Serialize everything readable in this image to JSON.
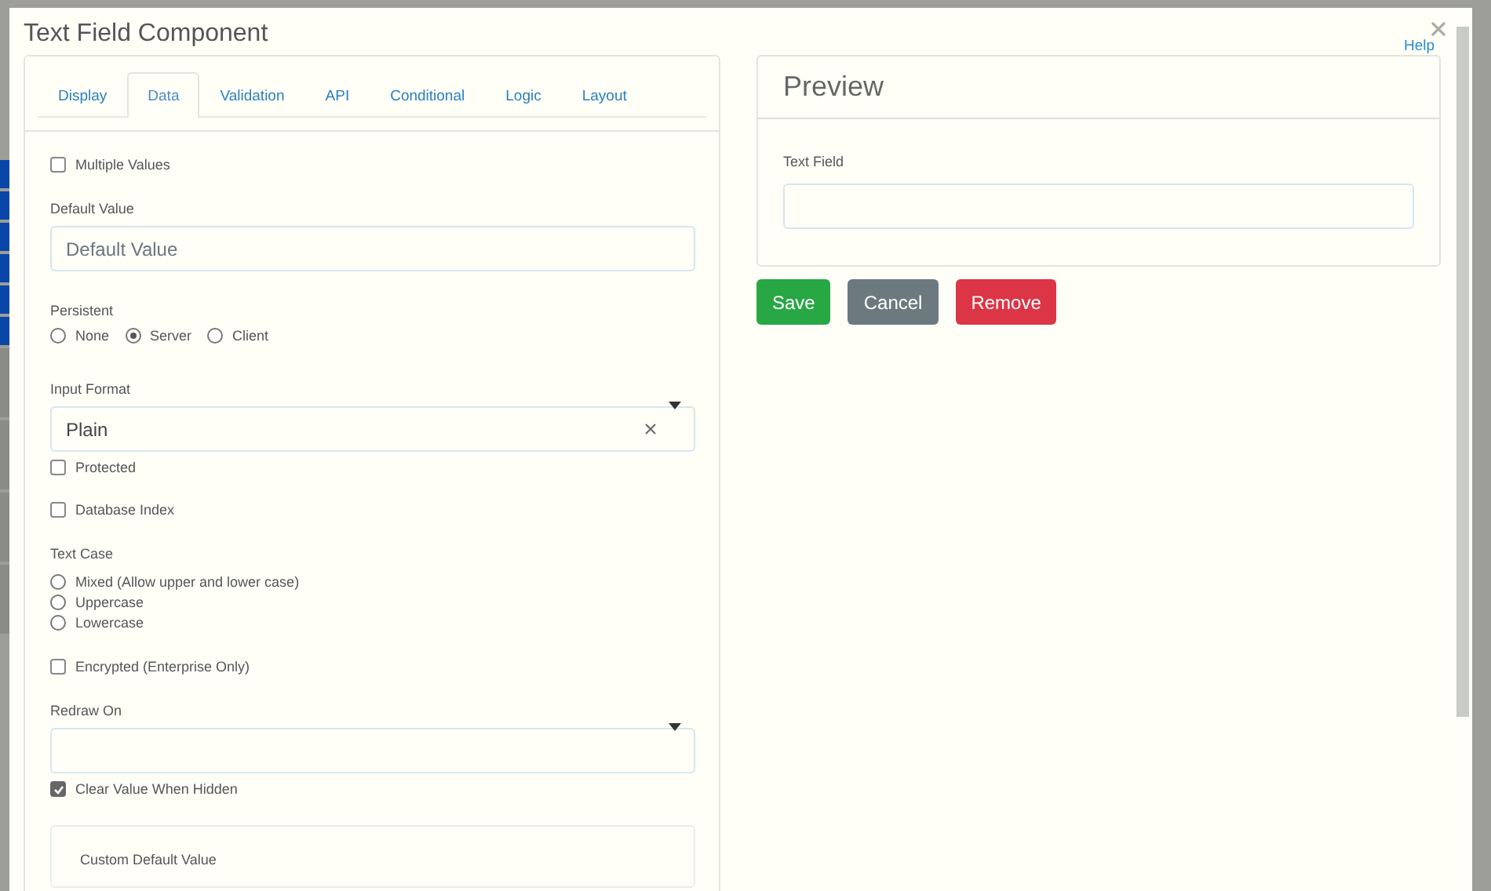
{
  "dialog": {
    "title": "Text Field Component",
    "help": "Help"
  },
  "tabs": [
    {
      "label": "Display",
      "selected": false
    },
    {
      "label": "Data",
      "selected": true
    },
    {
      "label": "Validation",
      "selected": false
    },
    {
      "label": "API",
      "selected": false
    },
    {
      "label": "Conditional",
      "selected": false
    },
    {
      "label": "Logic",
      "selected": false
    },
    {
      "label": "Layout",
      "selected": false
    }
  ],
  "fields": [
    {
      "kind": "checkbox",
      "label": "Multiple Values",
      "checked": false
    },
    {
      "kind": "text",
      "label": "Default Value",
      "placeholder": "Default Value"
    },
    {
      "kind": "radio_row",
      "label": "Persistent",
      "options": [
        {
          "label": "None",
          "selected": false
        },
        {
          "label": "Server",
          "selected": true
        },
        {
          "label": "Client",
          "selected": false
        }
      ]
    },
    {
      "kind": "select",
      "label": "Input Format",
      "value": "Plain",
      "clearable": true
    },
    {
      "kind": "checkbox",
      "label": "Protected",
      "checked": false
    },
    {
      "kind": "checkbox",
      "label": "Database Index",
      "checked": false
    },
    {
      "kind": "radio_list",
      "label": "Text Case",
      "options": [
        {
          "label": "Mixed (Allow upper and lower case)",
          "selected": false
        },
        {
          "label": "Uppercase",
          "selected": false
        },
        {
          "label": "Lowercase",
          "selected": false
        }
      ]
    },
    {
      "kind": "checkbox",
      "label": "Encrypted (Enterprise Only)",
      "checked": false
    },
    {
      "kind": "select",
      "label": "Redraw On",
      "clearable": false
    },
    {
      "kind": "checkbox",
      "label": "Clear Value When Hidden",
      "checked": true
    },
    {
      "kind": "panel",
      "label": "Custom Default Value"
    }
  ],
  "preview": {
    "title": "Preview",
    "field_label": "Text Field"
  },
  "buttons": [
    {
      "label": "Save",
      "kind": "success"
    },
    {
      "label": "Cancel",
      "kind": "secondary"
    },
    {
      "label": "Remove",
      "kind": "danger"
    }
  ]
}
